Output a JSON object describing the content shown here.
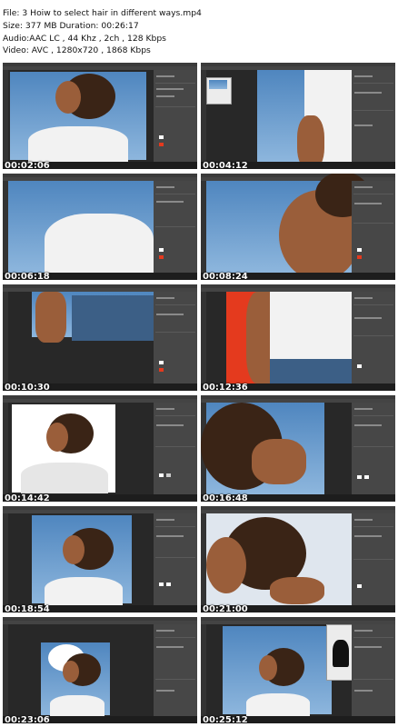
{
  "header": {
    "file_line": "File: 3  Hoiw to select hair in different ways.mp4",
    "size_line": "Size: 377 MB Duration: 00:26:17",
    "audio_line": "Audio:AAC LC , 44 Khz , 2ch , 128 Kbps",
    "video_line": "Video: AVC , 1280x720  , 1868 Kbps"
  },
  "thumbnails": [
    {
      "timestamp": "00:02:06"
    },
    {
      "timestamp": "00:04:12"
    },
    {
      "timestamp": "00:06:18"
    },
    {
      "timestamp": "00:08:24"
    },
    {
      "timestamp": "00:10:30"
    },
    {
      "timestamp": "00:12:36"
    },
    {
      "timestamp": "00:14:42"
    },
    {
      "timestamp": "00:16:48"
    },
    {
      "timestamp": "00:18:54"
    },
    {
      "timestamp": "00:21:00"
    },
    {
      "timestamp": "00:23:06"
    },
    {
      "timestamp": "00:25:12"
    }
  ],
  "colors": {
    "panel_gray": "#474747",
    "canvas_dark": "#282828",
    "sky_blue": "#6b9fd0",
    "swatch_red": "#e43a1e",
    "swatch_white": "#ffffff"
  }
}
